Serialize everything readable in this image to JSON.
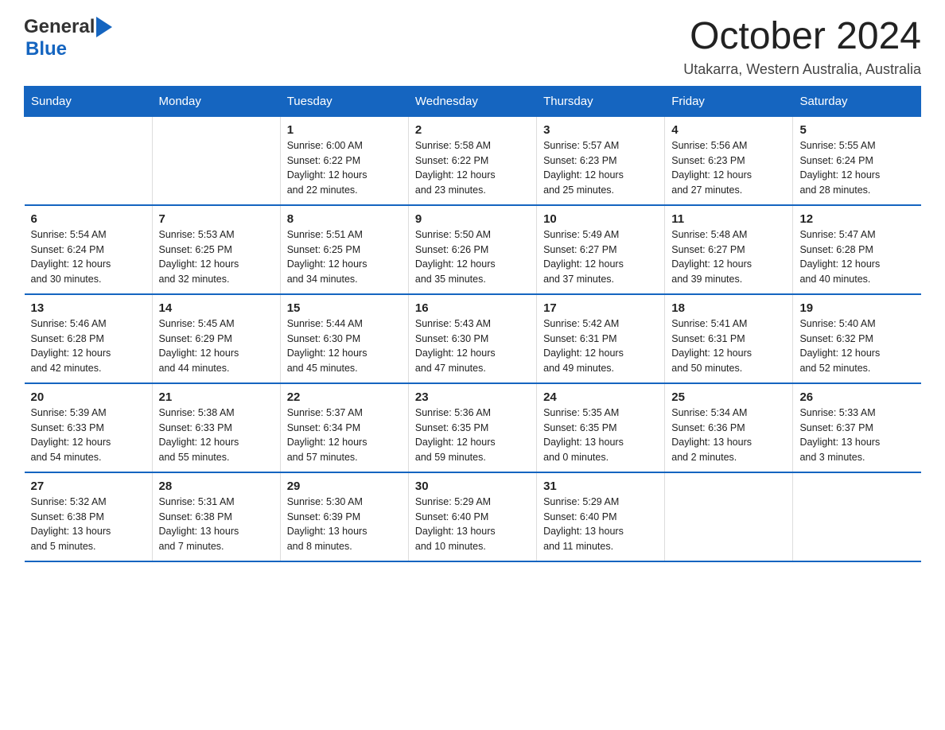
{
  "logo": {
    "general": "General",
    "blue": "Blue"
  },
  "header": {
    "month": "October 2024",
    "location": "Utakarra, Western Australia, Australia"
  },
  "weekdays": [
    "Sunday",
    "Monday",
    "Tuesday",
    "Wednesday",
    "Thursday",
    "Friday",
    "Saturday"
  ],
  "weeks": [
    [
      {
        "day": "",
        "info": ""
      },
      {
        "day": "",
        "info": ""
      },
      {
        "day": "1",
        "info": "Sunrise: 6:00 AM\nSunset: 6:22 PM\nDaylight: 12 hours\nand 22 minutes."
      },
      {
        "day": "2",
        "info": "Sunrise: 5:58 AM\nSunset: 6:22 PM\nDaylight: 12 hours\nand 23 minutes."
      },
      {
        "day": "3",
        "info": "Sunrise: 5:57 AM\nSunset: 6:23 PM\nDaylight: 12 hours\nand 25 minutes."
      },
      {
        "day": "4",
        "info": "Sunrise: 5:56 AM\nSunset: 6:23 PM\nDaylight: 12 hours\nand 27 minutes."
      },
      {
        "day": "5",
        "info": "Sunrise: 5:55 AM\nSunset: 6:24 PM\nDaylight: 12 hours\nand 28 minutes."
      }
    ],
    [
      {
        "day": "6",
        "info": "Sunrise: 5:54 AM\nSunset: 6:24 PM\nDaylight: 12 hours\nand 30 minutes."
      },
      {
        "day": "7",
        "info": "Sunrise: 5:53 AM\nSunset: 6:25 PM\nDaylight: 12 hours\nand 32 minutes."
      },
      {
        "day": "8",
        "info": "Sunrise: 5:51 AM\nSunset: 6:25 PM\nDaylight: 12 hours\nand 34 minutes."
      },
      {
        "day": "9",
        "info": "Sunrise: 5:50 AM\nSunset: 6:26 PM\nDaylight: 12 hours\nand 35 minutes."
      },
      {
        "day": "10",
        "info": "Sunrise: 5:49 AM\nSunset: 6:27 PM\nDaylight: 12 hours\nand 37 minutes."
      },
      {
        "day": "11",
        "info": "Sunrise: 5:48 AM\nSunset: 6:27 PM\nDaylight: 12 hours\nand 39 minutes."
      },
      {
        "day": "12",
        "info": "Sunrise: 5:47 AM\nSunset: 6:28 PM\nDaylight: 12 hours\nand 40 minutes."
      }
    ],
    [
      {
        "day": "13",
        "info": "Sunrise: 5:46 AM\nSunset: 6:28 PM\nDaylight: 12 hours\nand 42 minutes."
      },
      {
        "day": "14",
        "info": "Sunrise: 5:45 AM\nSunset: 6:29 PM\nDaylight: 12 hours\nand 44 minutes."
      },
      {
        "day": "15",
        "info": "Sunrise: 5:44 AM\nSunset: 6:30 PM\nDaylight: 12 hours\nand 45 minutes."
      },
      {
        "day": "16",
        "info": "Sunrise: 5:43 AM\nSunset: 6:30 PM\nDaylight: 12 hours\nand 47 minutes."
      },
      {
        "day": "17",
        "info": "Sunrise: 5:42 AM\nSunset: 6:31 PM\nDaylight: 12 hours\nand 49 minutes."
      },
      {
        "day": "18",
        "info": "Sunrise: 5:41 AM\nSunset: 6:31 PM\nDaylight: 12 hours\nand 50 minutes."
      },
      {
        "day": "19",
        "info": "Sunrise: 5:40 AM\nSunset: 6:32 PM\nDaylight: 12 hours\nand 52 minutes."
      }
    ],
    [
      {
        "day": "20",
        "info": "Sunrise: 5:39 AM\nSunset: 6:33 PM\nDaylight: 12 hours\nand 54 minutes."
      },
      {
        "day": "21",
        "info": "Sunrise: 5:38 AM\nSunset: 6:33 PM\nDaylight: 12 hours\nand 55 minutes."
      },
      {
        "day": "22",
        "info": "Sunrise: 5:37 AM\nSunset: 6:34 PM\nDaylight: 12 hours\nand 57 minutes."
      },
      {
        "day": "23",
        "info": "Sunrise: 5:36 AM\nSunset: 6:35 PM\nDaylight: 12 hours\nand 59 minutes."
      },
      {
        "day": "24",
        "info": "Sunrise: 5:35 AM\nSunset: 6:35 PM\nDaylight: 13 hours\nand 0 minutes."
      },
      {
        "day": "25",
        "info": "Sunrise: 5:34 AM\nSunset: 6:36 PM\nDaylight: 13 hours\nand 2 minutes."
      },
      {
        "day": "26",
        "info": "Sunrise: 5:33 AM\nSunset: 6:37 PM\nDaylight: 13 hours\nand 3 minutes."
      }
    ],
    [
      {
        "day": "27",
        "info": "Sunrise: 5:32 AM\nSunset: 6:38 PM\nDaylight: 13 hours\nand 5 minutes."
      },
      {
        "day": "28",
        "info": "Sunrise: 5:31 AM\nSunset: 6:38 PM\nDaylight: 13 hours\nand 7 minutes."
      },
      {
        "day": "29",
        "info": "Sunrise: 5:30 AM\nSunset: 6:39 PM\nDaylight: 13 hours\nand 8 minutes."
      },
      {
        "day": "30",
        "info": "Sunrise: 5:29 AM\nSunset: 6:40 PM\nDaylight: 13 hours\nand 10 minutes."
      },
      {
        "day": "31",
        "info": "Sunrise: 5:29 AM\nSunset: 6:40 PM\nDaylight: 13 hours\nand 11 minutes."
      },
      {
        "day": "",
        "info": ""
      },
      {
        "day": "",
        "info": ""
      }
    ]
  ]
}
